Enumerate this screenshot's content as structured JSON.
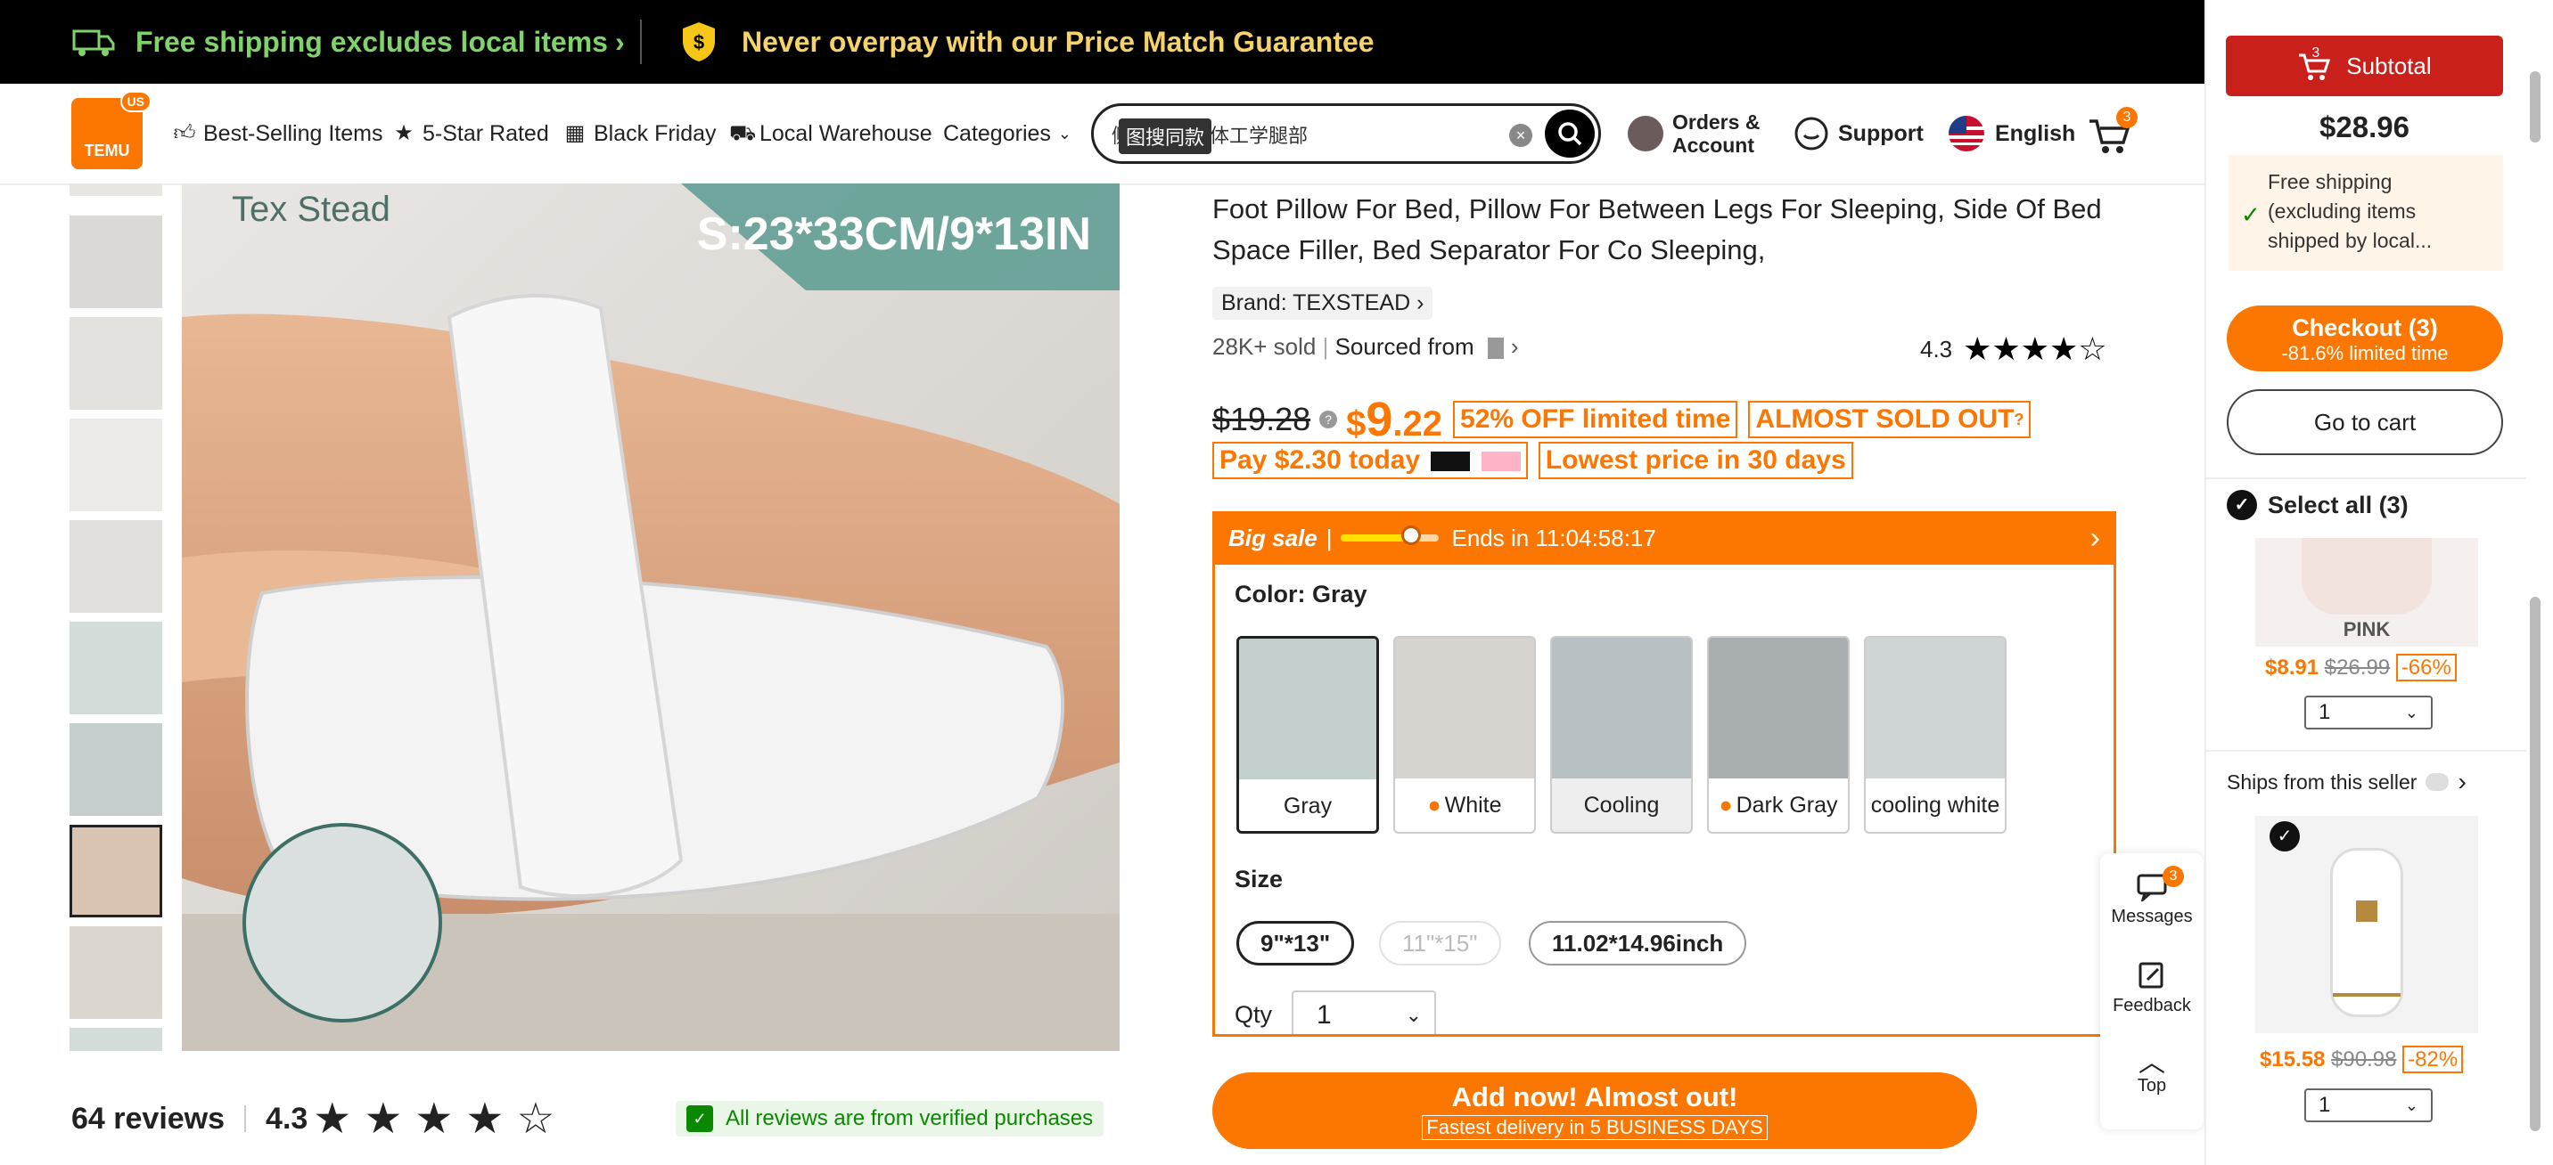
{
  "banner": {
    "shipping": "Free shipping excludes local items",
    "price_match": "Never overpay with our Price Match Guarantee"
  },
  "header": {
    "logo_text": "TEMU",
    "region_badge": "US",
    "nav": [
      "Best-Selling Items",
      "5-Star Rated",
      "Black Friday",
      "Local Warehouse",
      "Categories"
    ],
    "search_value": "侧睡腿枕人体工学腿部",
    "search_tip": "图搜同款",
    "orders_line1": "Orders &",
    "orders_line2": "Account",
    "support": "Support",
    "language": "English",
    "cart_count": "3"
  },
  "gallery": {
    "brand_watermark": "Tex Stead",
    "size_overlay": "S:23*33CM/9*13IN"
  },
  "reviews": {
    "count": "64 reviews",
    "rating": "4.3",
    "verified": "All reviews are from verified purchases"
  },
  "product": {
    "title": "Foot Pillow For Bed, Pillow For Between Legs For Sleeping, Side Of Bed Space Filler, Bed Separator For Co Sleeping,",
    "brand": "Brand: TEXSTEAD",
    "sold": "28K+ sold",
    "sourced": "Sourced from",
    "rating": "4.3",
    "old_price": "$19.28",
    "price_dollar": "$",
    "price_int": "9",
    "price_dec": ".22",
    "tag_off": "52% OFF limited time",
    "tag_sold_out": "ALMOST SOLD OUT",
    "pay_today": "Pay $2.30 today",
    "lowest": "Lowest price in 30 days"
  },
  "sale": {
    "label": "Big sale",
    "ends": "Ends in 11:04:58:17"
  },
  "variants": {
    "color_label": "Color: Gray",
    "colors": [
      "Gray",
      "White",
      "Cooling",
      "Dark Gray",
      "cooling white"
    ],
    "size_label": "Size",
    "sizes": [
      "9\"*13\"",
      "11\"*15\"",
      "11.02*14.96inch"
    ],
    "qty_label": "Qty",
    "qty_value": "1"
  },
  "add_button": {
    "main": "Add now! Almost out!",
    "sub": "Fastest delivery in 5 BUSINESS DAYS"
  },
  "tools": {
    "messages": "Messages",
    "messages_badge": "3",
    "feedback": "Feedback",
    "top": "Top"
  },
  "cart": {
    "subtotal_label": "Subtotal",
    "subtotal_badge": "3",
    "subtotal": "$28.96",
    "freeship": "Free shipping (excluding items shipped by local...",
    "checkout": "Checkout (3)",
    "checkout_sub": "-81.6% limited time",
    "goto": "Go to cart",
    "select_all": "Select all (3)",
    "item1_variant": "PINK",
    "item1_price": "$8.91",
    "item1_old": "$26.99",
    "item1_disc": "-66%",
    "item1_qty": "1",
    "ships_from": "Ships from this seller",
    "item2_price": "$15.58",
    "item2_old": "$90.98",
    "item2_disc": "-82%",
    "item2_qty": "1"
  },
  "colors": {
    "accent": "#fb7701",
    "banner_bg": "#000000",
    "banner_text": "#7fd36a",
    "subtotal_bg": "#c9201b"
  }
}
